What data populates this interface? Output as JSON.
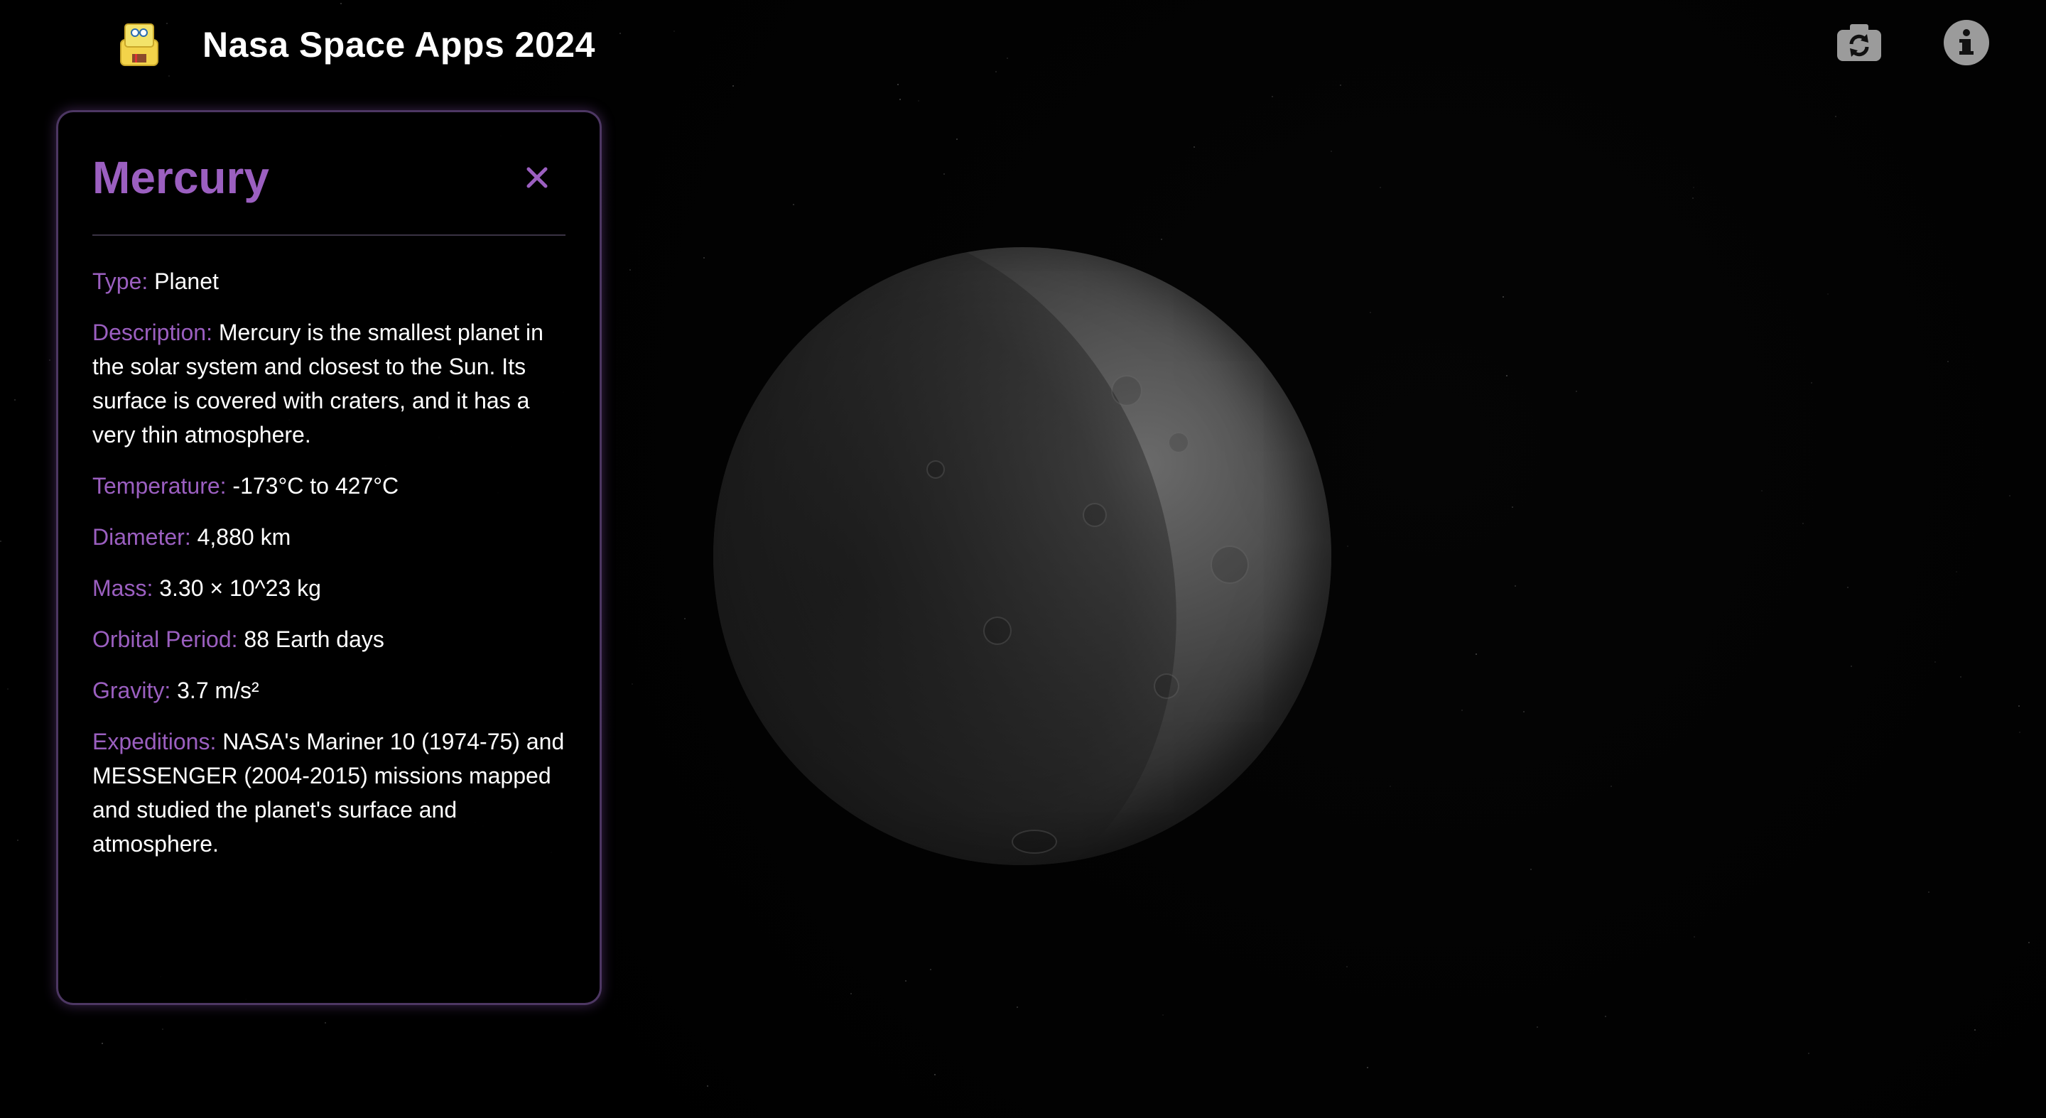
{
  "app": {
    "title": "Nasa Space Apps 2024"
  },
  "header": {
    "logo_icon": "spongebob-chair-icon",
    "camera_button_icon": "camera-rotate-icon",
    "info_button_icon": "info-icon"
  },
  "panel": {
    "title": "Mercury",
    "close_icon": "close-icon",
    "fields": [
      {
        "label": "Type:",
        "value": "Planet"
      },
      {
        "label": "Description:",
        "value": "Mercury is the smallest planet in the solar system and closest to the Sun. Its surface is covered with craters, and it has a very thin atmosphere."
      },
      {
        "label": "Temperature:",
        "value": "-173°C to 427°C"
      },
      {
        "label": "Diameter:",
        "value": "4,880 km"
      },
      {
        "label": "Mass:",
        "value": "3.30 × 10^23 kg"
      },
      {
        "label": "Orbital Period:",
        "value": "88 Earth days"
      },
      {
        "label": "Gravity:",
        "value": "3.7 m/s²"
      },
      {
        "label": "Expeditions:",
        "value": "NASA's Mariner 10 (1974-75) and MESSENGER (2004-2015) missions mapped and studied the planet's surface and atmosphere."
      }
    ]
  },
  "colors": {
    "accent": "#9b5fc0",
    "background": "#000000",
    "text": "#ffffff"
  }
}
